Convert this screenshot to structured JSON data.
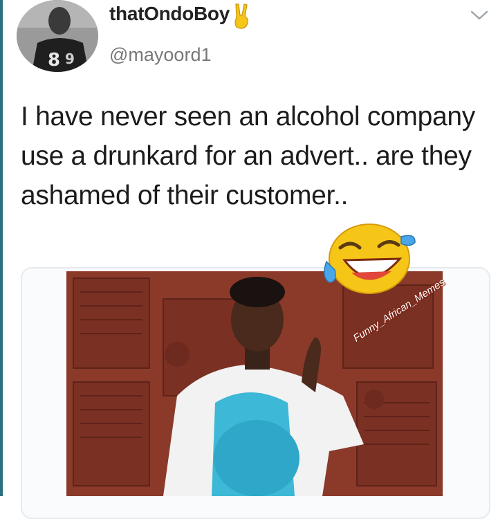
{
  "tweet": {
    "display_name": "thatOndoBoy",
    "handle": "@mayoord1",
    "text": "I have never seen an alcohol company use a drunkard for an advert.. are they ashamed of their customer..",
    "name_emoji": "victory-hand-icon",
    "menu_icon": "chevron-down-icon"
  },
  "media": {
    "watermark": "Funny_African_Memes",
    "emoji": "face-with-tears-of-joy-icon"
  },
  "colors": {
    "accent_edge": "#2b6f7d",
    "emoji_yellow": "#f5c518",
    "door_brown": "#8b3a2a"
  }
}
